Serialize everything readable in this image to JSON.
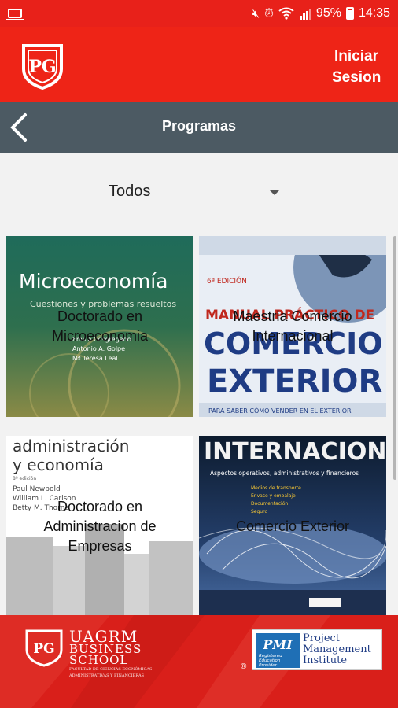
{
  "status_bar": {
    "battery": "95%",
    "time": "14:35",
    "icons": [
      "laptop-icon",
      "mute-icon",
      "alarm-icon",
      "wifi-icon",
      "signal-icon",
      "battery-icon"
    ]
  },
  "header": {
    "logo_text": "PG",
    "login_label_line1": "Iniciar",
    "login_label_line2": "Sesion",
    "brand_color": "#ee2417"
  },
  "navbar": {
    "back_icon": "chevron-left-icon",
    "title": "Programas",
    "color": "#4c5a63"
  },
  "filter": {
    "selected": "Todos"
  },
  "programs": [
    {
      "title": "Doctorado en Microeconomia",
      "cover_heading": "Microeconomía",
      "cover_sub": "Cuestiones y problemas resueltos",
      "cover_authors": [
        "Emilio Cosgregado",
        "Antonio A. Golpe",
        "Mª Teresa Leal"
      ]
    },
    {
      "title": "Maestria Comercio Internacional",
      "cover_heading_1": "COMERCIO",
      "cover_heading_2": "EXTERIOR",
      "cover_top": "MANUAL PRÁCTICO DE",
      "cover_edition": "6ª EDICIÓN",
      "cover_bottom": "PARA SABER CÓMO VENDER EN EL EXTERIOR"
    },
    {
      "title": "Doctorado en Administracion de Empresas",
      "cover_heading_1": "administración",
      "cover_heading_2": "y economía",
      "cover_edition": "8ª edición",
      "cover_authors": [
        "Paul Newbold",
        "William L. Carlson",
        "Betty M. Thorne"
      ]
    },
    {
      "title": "Comercio Exterior",
      "cover_heading": "INTERNACIONAL",
      "cover_sub": "Aspectos operativos, administrativos y financieros",
      "cover_bullets": [
        "Medios de transporte",
        "Envase y embalaje",
        "Documentación",
        "Seguro"
      ]
    }
  ],
  "footer": {
    "school_name": "UAGRM",
    "school_sub": "BUSINESS",
    "school_sub2": "SCHOOL",
    "school_small_1": "FACULTAD DE CIENCIAS ECONÓMICAS",
    "school_small_2": "ADMINISTRATIVAS Y FINANCIERAS",
    "pmi_line1": "Project",
    "pmi_line2": "Management",
    "pmi_line3": "Institute",
    "pmi_badge_1": "Registered",
    "pmi_badge_2": "Education",
    "pmi_badge_3": "Provider",
    "registered_mark": "®"
  }
}
